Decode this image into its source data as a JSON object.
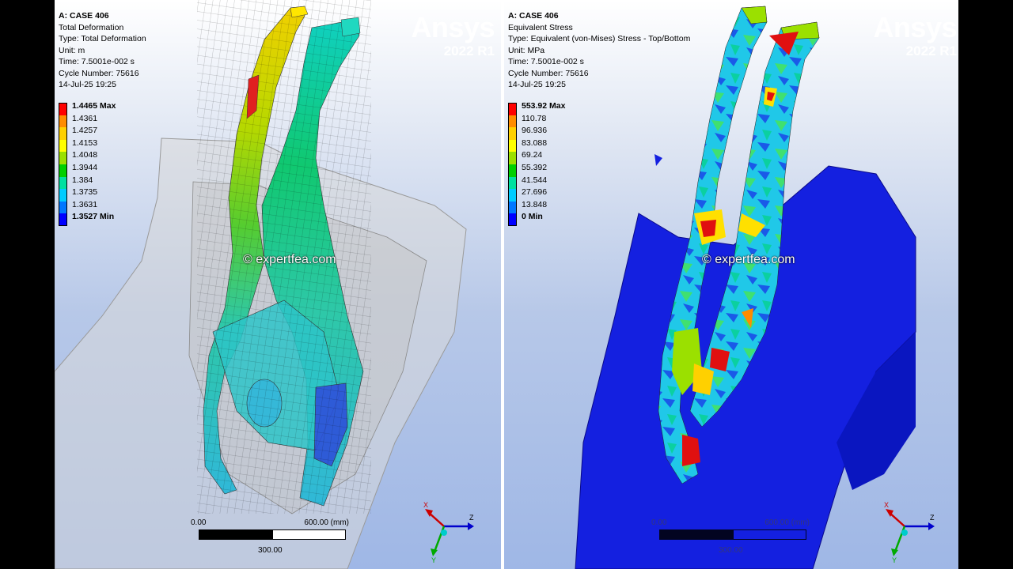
{
  "left_panel": {
    "case": "A: CASE 406",
    "result": "Total Deformation",
    "type": "Type: Total Deformation",
    "unit": "Unit: m",
    "time": "Time: 7.5001e-002 s",
    "cycle": "Cycle Number: 75616",
    "date": "14-Jul-25 19:25",
    "legend": [
      {
        "label": "1.4465 Max",
        "color": "#ff0000"
      },
      {
        "label": "1.4361",
        "color": "#ff8c00"
      },
      {
        "label": "1.4257",
        "color": "#ffd000"
      },
      {
        "label": "1.4153",
        "color": "#ffff00"
      },
      {
        "label": "1.4048",
        "color": "#9be000"
      },
      {
        "label": "1.3944",
        "color": "#00d000"
      },
      {
        "label": "1.384",
        "color": "#00e0a0"
      },
      {
        "label": "1.3735",
        "color": "#00ccff"
      },
      {
        "label": "1.3631",
        "color": "#0077ff"
      },
      {
        "label": "1.3527 Min",
        "color": "#0000ff"
      }
    ],
    "scale": {
      "start": "0.00",
      "end": "600.00 (mm)",
      "mid": "300.00"
    }
  },
  "right_panel": {
    "case": "A: CASE 406",
    "result": "Equivalent Stress",
    "type": "Type: Equivalent (von-Mises) Stress - Top/Bottom",
    "unit": "Unit: MPa",
    "time": "Time: 7.5001e-002 s",
    "cycle": "Cycle Number: 75616",
    "date": "14-Jul-25 19:25",
    "legend": [
      {
        "label": "553.92 Max",
        "color": "#ff0000"
      },
      {
        "label": "110.78",
        "color": "#ff8c00"
      },
      {
        "label": "96.936",
        "color": "#ffd000"
      },
      {
        "label": "83.088",
        "color": "#ffff00"
      },
      {
        "label": "69.24",
        "color": "#9be000"
      },
      {
        "label": "55.392",
        "color": "#00d000"
      },
      {
        "label": "41.544",
        "color": "#00e0a0"
      },
      {
        "label": "27.696",
        "color": "#00ccff"
      },
      {
        "label": "13.848",
        "color": "#0077ff"
      },
      {
        "label": "0 Min",
        "color": "#0000ff"
      }
    ],
    "scale": {
      "start": "0.00",
      "end": "600.00 (mm)",
      "mid": "300.00"
    }
  },
  "logo": {
    "brand": "Ansys",
    "version": "2022 R1"
  },
  "watermark": "© expertfea.com",
  "axes": {
    "x": "X",
    "y": "Y",
    "z": "Z"
  }
}
